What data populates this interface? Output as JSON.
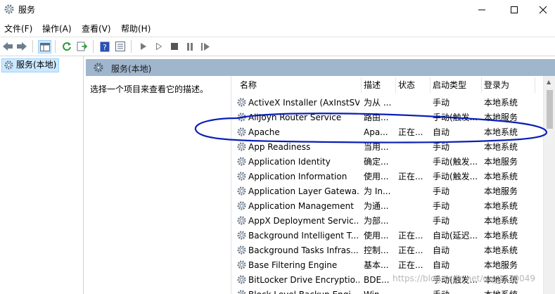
{
  "window": {
    "title": "服务"
  },
  "menu": [
    {
      "label": "文件(F)"
    },
    {
      "label": "操作(A)"
    },
    {
      "label": "查看(V)"
    },
    {
      "label": "帮助(H)"
    }
  ],
  "tree": {
    "selected_label": "服务(本地)"
  },
  "pane": {
    "header_title": "服务(本地)",
    "description_prompt": "选择一个项目来查看它的描述。"
  },
  "table": {
    "columns": {
      "name": "名称",
      "desc": "描述",
      "state": "状态",
      "startup": "启动类型",
      "logon": "登录为"
    },
    "rows": [
      {
        "name": "ActiveX Installer (AxInstSV)",
        "desc": "为从 ...",
        "state": "",
        "startup": "手动",
        "logon": "本地系统"
      },
      {
        "name": "AllJoyn Router Service",
        "desc": "路由...",
        "state": "",
        "startup": "手动(触发...",
        "logon": "本地服务"
      },
      {
        "name": "Apache",
        "desc": "Apa...",
        "state": "正在...",
        "startup": "自动",
        "logon": "本地系统"
      },
      {
        "name": "App Readiness",
        "desc": "当用...",
        "state": "",
        "startup": "手动",
        "logon": "本地系统"
      },
      {
        "name": "Application Identity",
        "desc": "确定...",
        "state": "",
        "startup": "手动(触发...",
        "logon": "本地服务"
      },
      {
        "name": "Application Information",
        "desc": "使用...",
        "state": "正在...",
        "startup": "手动(触发...",
        "logon": "本地系统"
      },
      {
        "name": "Application Layer Gatewa...",
        "desc": "为 In...",
        "state": "",
        "startup": "手动",
        "logon": "本地服务"
      },
      {
        "name": "Application Management",
        "desc": "为通...",
        "state": "",
        "startup": "手动",
        "logon": "本地系统"
      },
      {
        "name": "AppX Deployment Servic...",
        "desc": "为部...",
        "state": "",
        "startup": "手动",
        "logon": "本地系统"
      },
      {
        "name": "Background Intelligent T...",
        "desc": "使用...",
        "state": "正在...",
        "startup": "自动(延迟...",
        "logon": "本地系统"
      },
      {
        "name": "Background Tasks Infras...",
        "desc": "控制...",
        "state": "正在...",
        "startup": "自动",
        "logon": "本地系统"
      },
      {
        "name": "Base Filtering Engine",
        "desc": "基本...",
        "state": "正在...",
        "startup": "自动",
        "logon": "本地服务"
      },
      {
        "name": "BitLocker Drive Encryptio...",
        "desc": "BDE...",
        "state": "",
        "startup": "手动(触发...",
        "logon": "本地系统"
      },
      {
        "name": "Block Level Backup Engi...",
        "desc": "Win...",
        "state": "",
        "startup": "手动",
        "logon": "本地系统"
      }
    ]
  },
  "watermark": "https://blog.csdn.net/qq_4270049",
  "colors": {
    "pane_header": "#9fb6cd",
    "selection": "#cce8ff",
    "annotation": "#0a1fb4"
  }
}
